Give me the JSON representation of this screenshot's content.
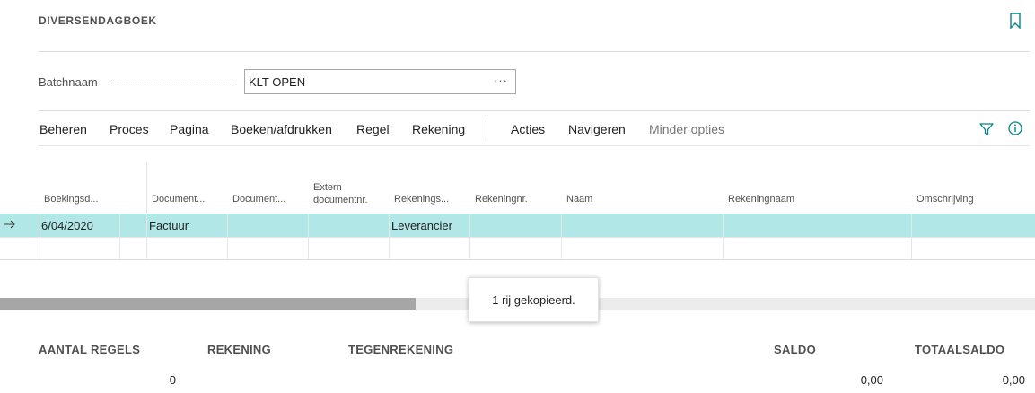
{
  "page": {
    "title": "DIVERSENDAGBOEK"
  },
  "batch": {
    "label": "Batchnaam",
    "value": "KLT OPEN",
    "more": "···"
  },
  "menu": {
    "items": [
      "Beheren",
      "Proces",
      "Pagina",
      "Boeken/afdrukken",
      "Regel",
      "Rekening",
      "Acties",
      "Navigeren"
    ],
    "less_options": "Minder opties"
  },
  "icons": {
    "bookmark": "bookmark-icon",
    "filter": "filter-icon",
    "info": "info-icon",
    "row_arrow": "arrow-right-icon"
  },
  "grid": {
    "columns": [
      "Boekingsd...",
      "Document...",
      "Document...",
      "Extern documentnr.",
      "Rekenings...",
      "Rekeningnr.",
      "Naam",
      "Rekeningnaam",
      "Omschrijving"
    ],
    "rows": [
      {
        "cells": [
          "6/04/2020",
          "Factuur",
          "",
          "",
          "Leverancier",
          "",
          "",
          "",
          ""
        ]
      },
      {
        "cells": [
          "",
          "",
          "",
          "",
          "",
          "",
          "",
          "",
          ""
        ]
      }
    ]
  },
  "toast": {
    "message": "1 rij gekopieerd."
  },
  "summary": {
    "labels": [
      "AANTAL REGELS",
      "REKENING",
      "TEGENREKENING",
      "SALDO",
      "TOTAALSALDO"
    ],
    "values": {
      "aantal_regels": "0",
      "saldo": "0,00",
      "totaalsaldo": "0,00"
    }
  },
  "colors": {
    "selected_row": "#b2e7e8",
    "accent": "#00858a",
    "scroll_thumb": "#a6a6a6"
  }
}
